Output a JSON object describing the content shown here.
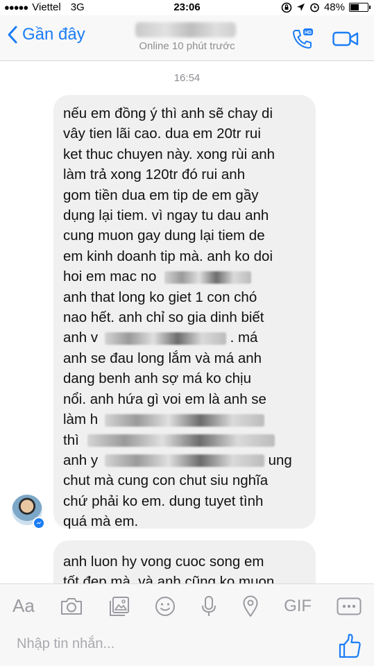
{
  "status_bar": {
    "signal_dots": "●●●●●",
    "carrier": "Viettel",
    "network": "3G",
    "time": "23:06",
    "battery": "48%",
    "battery_level": 0.48
  },
  "header": {
    "back_label": "Gần đây",
    "presence": "Online 10 phút trước"
  },
  "chat": {
    "timestamp": "16:54",
    "message1": {
      "lines": [
        "nếu em đồng ý thì anh sẽ chay di",
        "vây tien lãi cao. dua em 20tr rui",
        "ket thuc chuyen này. xong rùi anh",
        "làm trả xong 120tr đó rui anh",
        "gom tiền dua em tip de em gầy",
        "dụng lại tiem. vì ngay tu dau anh",
        "cung muon gay dung lại tiem de",
        "em kinh doanh tip mà. anh ko doi",
        "hoi em mac no",
        "anh that long ko giet 1 con chó",
        "nao hết. anh chỉ so gia dinh biết",
        "anh v",
        ". má",
        "anh se đau long lắm và má anh",
        "dang benh anh sợ má ko chịu",
        "nổi. anh hứa gì voi em là anh se",
        "làm h",
        "thì",
        "anh y",
        "ung",
        "chut mà cung con chut siu nghĩa",
        "chứ phải ko em. dung tuyet tình",
        "quá mà em."
      ]
    },
    "message2": {
      "lines": [
        "anh luon hy vong cuoc song em",
        "tốt đẹp mà. và anh cũng ko muon"
      ]
    }
  },
  "toolbar": {
    "aa_label": "Aa",
    "gif_label": "GIF",
    "icons": [
      "camera-icon",
      "gallery-icon",
      "emoji-icon",
      "microphone-icon",
      "location-icon",
      "more-icon"
    ]
  },
  "composer": {
    "placeholder": "Nhập tin nhắn..."
  },
  "colors": {
    "accent": "#1a7cf5",
    "bubble": "#f1f0f0",
    "muted": "#8e8e93"
  }
}
